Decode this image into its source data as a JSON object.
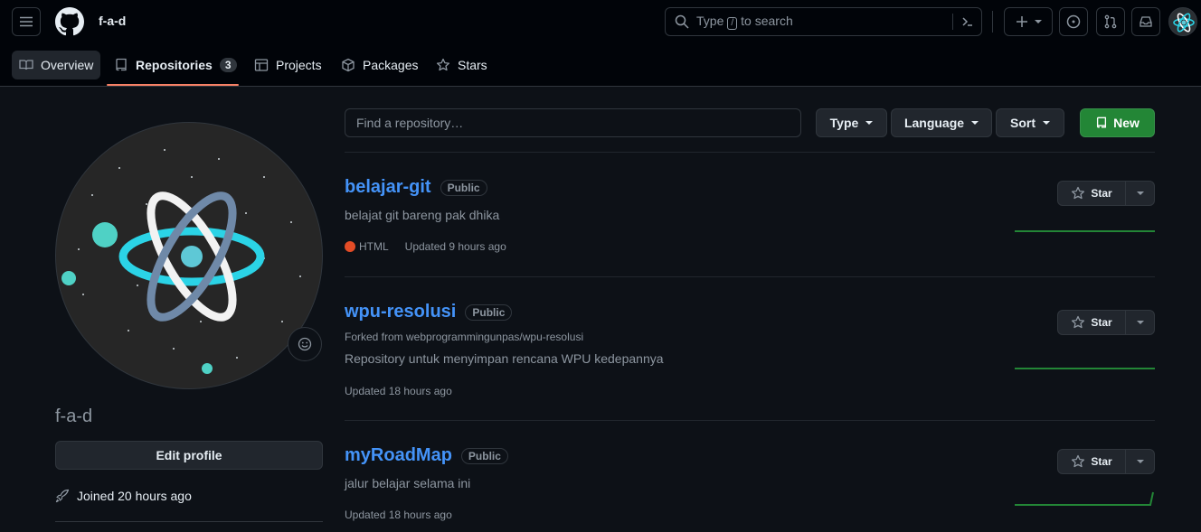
{
  "header": {
    "username": "f-a-d",
    "search_placeholder_prefix": "Type",
    "search_key": "/",
    "search_placeholder_suffix": "to search",
    "icons": [
      "menu-icon",
      "github-logo",
      "search-icon",
      "command-palette-icon",
      "plus-icon",
      "issue-opened-icon",
      "git-pull-request-icon",
      "inbox-icon"
    ]
  },
  "tabs": [
    {
      "label": "Overview",
      "icon": "book-icon"
    },
    {
      "label": "Repositories",
      "icon": "repo-icon",
      "count": "3",
      "selected": true
    },
    {
      "label": "Projects",
      "icon": "table-icon"
    },
    {
      "label": "Packages",
      "icon": "package-icon"
    },
    {
      "label": "Stars",
      "icon": "star-icon"
    }
  ],
  "profile": {
    "name": "f-a-d",
    "edit_label": "Edit profile",
    "joined": "Joined 20 hours ago"
  },
  "filters": {
    "find_placeholder": "Find a repository…",
    "type_label": "Type",
    "language_label": "Language",
    "sort_label": "Sort",
    "new_label": "New"
  },
  "repos": [
    {
      "name": "belajar-git",
      "visibility": "Public",
      "forked_from": "",
      "description": "belajat git bareng pak dhika",
      "language": "HTML",
      "language_color": "#e34c26",
      "updated": "Updated 9 hours ago",
      "star_label": "Star"
    },
    {
      "name": "wpu-resolusi",
      "visibility": "Public",
      "forked_from": "Forked from webprogrammingunpas/wpu-resolusi",
      "description": "Repository untuk menyimpan rencana WPU kedepannya",
      "language": "",
      "language_color": "",
      "updated": "Updated 18 hours ago",
      "star_label": "Star"
    },
    {
      "name": "myRoadMap",
      "visibility": "Public",
      "forked_from": "",
      "description": "jalur belajar selama ini",
      "language": "",
      "language_color": "",
      "updated": "Updated 18 hours ago",
      "star_label": "Star"
    }
  ],
  "colors": {
    "accent_link": "#4493f8",
    "new_button": "#238636",
    "tab_underline": "#f78166",
    "sparkline": "#238636"
  }
}
